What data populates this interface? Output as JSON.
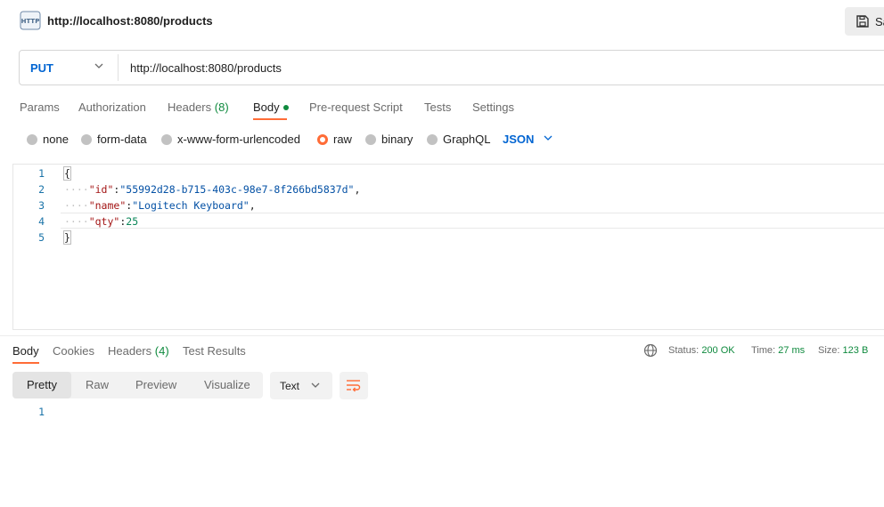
{
  "header": {
    "title": "http://localhost:8080/products",
    "save_label": "Save"
  },
  "request": {
    "method": "PUT",
    "url": "http://localhost:8080/products"
  },
  "request_tabs": {
    "params": "Params",
    "authorization": "Authorization",
    "headers": "Headers",
    "headers_count": "(8)",
    "body": "Body",
    "pre_request": "Pre-request Script",
    "tests": "Tests",
    "settings": "Settings"
  },
  "body_types": {
    "none": "none",
    "form_data": "form-data",
    "urlencoded": "x-www-form-urlencoded",
    "raw": "raw",
    "binary": "binary",
    "graphql": "GraphQL",
    "selected": "raw",
    "language": "JSON"
  },
  "editor": {
    "line_numbers": [
      "1",
      "2",
      "3",
      "4",
      "5"
    ],
    "open_brace": "{",
    "close_brace": "}",
    "id_key": "\"id\"",
    "id_value": "\"55992d28-b715-403c-98e7-8f266bd5837d\"",
    "name_key": "\"name\"",
    "name_value": "\"Logitech Keyboard\"",
    "qty_key": "\"qty\"",
    "qty_value": "25"
  },
  "response_tabs": {
    "body": "Body",
    "cookies": "Cookies",
    "headers": "Headers",
    "headers_count": "(4)",
    "test_results": "Test Results"
  },
  "status": {
    "status_label": "Status:",
    "status_value": "200 OK",
    "time_label": "Time:",
    "time_value": "27 ms",
    "size_label": "Size:",
    "size_value": "123 B"
  },
  "response_view": {
    "pretty": "Pretty",
    "raw": "Raw",
    "preview": "Preview",
    "visualize": "Visualize",
    "format": "Text",
    "line_numbers": [
      "1"
    ]
  },
  "colors": {
    "accent": "#ff6c37",
    "method": "#0265d2",
    "success": "#0f8a3e"
  }
}
